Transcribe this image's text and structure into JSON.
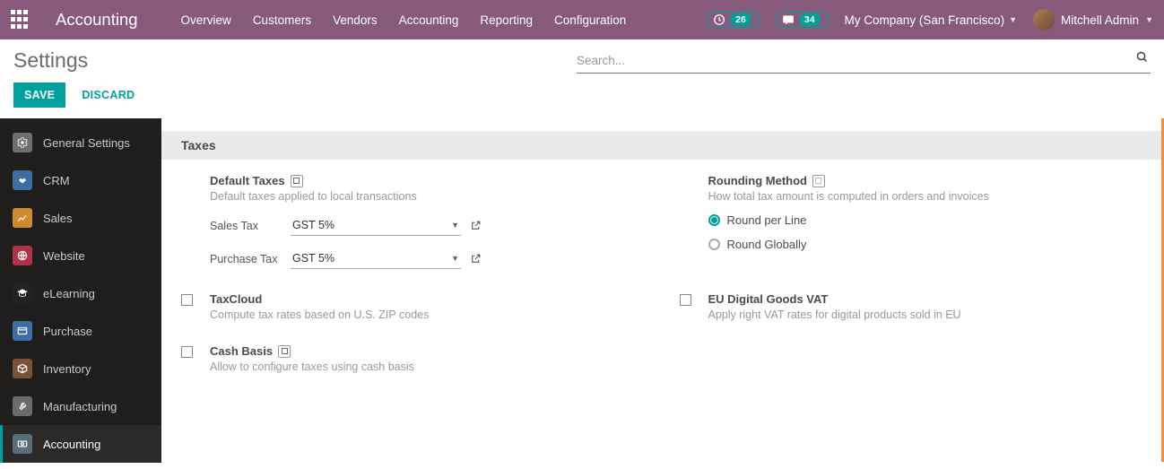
{
  "topbar": {
    "brand": "Accounting",
    "nav": [
      "Overview",
      "Customers",
      "Vendors",
      "Accounting",
      "Reporting",
      "Configuration"
    ],
    "activity_count": "26",
    "chat_count": "34",
    "company": "My Company (San Francisco)",
    "user": "Mitchell Admin"
  },
  "page": {
    "title": "Settings",
    "search_placeholder": "Search...",
    "save": "SAVE",
    "discard": "DISCARD"
  },
  "sidebar": {
    "items": [
      {
        "label": "General Settings",
        "color": "#6e6e6e"
      },
      {
        "label": "CRM",
        "color": "#3b6ea5"
      },
      {
        "label": "Sales",
        "color": "#d08a2f"
      },
      {
        "label": "Website",
        "color": "#b23345"
      },
      {
        "label": "eLearning",
        "color": "#222"
      },
      {
        "label": "Purchase",
        "color": "#3c6fa6"
      },
      {
        "label": "Inventory",
        "color": "#7a5238"
      },
      {
        "label": "Manufacturing",
        "color": "#6b6b6b"
      },
      {
        "label": "Accounting",
        "color": "#5a6e7a"
      }
    ]
  },
  "taxes": {
    "section": "Taxes",
    "default_taxes": {
      "title": "Default Taxes",
      "desc": "Default taxes applied to local transactions",
      "sales_label": "Sales Tax",
      "sales_value": "GST 5%",
      "purchase_label": "Purchase Tax",
      "purchase_value": "GST 5%"
    },
    "rounding": {
      "title": "Rounding Method",
      "desc": "How total tax amount is computed in orders and invoices",
      "opt1": "Round per Line",
      "opt2": "Round Globally"
    },
    "taxcloud": {
      "title": "TaxCloud",
      "desc": "Compute tax rates based on U.S. ZIP codes"
    },
    "eu_vat": {
      "title": "EU Digital Goods VAT",
      "desc": "Apply right VAT rates for digital products sold in EU"
    },
    "cash_basis": {
      "title": "Cash Basis",
      "desc": "Allow to configure taxes using cash basis"
    }
  }
}
